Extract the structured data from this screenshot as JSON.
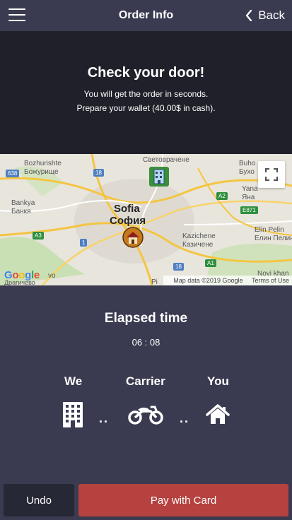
{
  "header": {
    "title": "Order Info",
    "back_label": "Back"
  },
  "banner": {
    "heading": "Check your door!",
    "line1": "You will get the order in seconds.",
    "line2": "Prepare your wallet (40.00$ in cash)."
  },
  "map": {
    "city_latin": "Sofia",
    "city_cyrillic": "София",
    "labels": {
      "bozhurishte": "Bozhurishte",
      "bozhurishte_cyr": "Божурище",
      "svetovrachene": "Световрачене",
      "bukhovo": "Buho",
      "bukhovo_cyr": "Бухо",
      "bankya": "Bankya",
      "bankya_cyr": "Банкя",
      "yana": "Yana",
      "yana_cyr": "Яна",
      "elin_pelin": "Elin Pelin",
      "elin_pelin_cyr": "Елин Пелин",
      "kazichene": "Kazichene",
      "kazichene_cyr": "Казичене",
      "novi_khan": "Novi khan",
      "vo": "vo",
      "dragichevo": "Драгичево",
      "pi": "Pi"
    },
    "road_tags": {
      "r638": "638",
      "r18a": "18",
      "a2": "A2",
      "e871": "E871",
      "a3": "A3",
      "r1": "1",
      "r18b": "18",
      "a1": "A1"
    },
    "google_logo": "Google",
    "attribution": "Map data ©2019 Google",
    "terms": "Terms of Use"
  },
  "elapsed": {
    "title": "Elapsed time",
    "time": "06 : 08"
  },
  "progress": {
    "we_label": "We",
    "carrier_label": "Carrier",
    "you_label": "You",
    "dots_left": "..",
    "dots_right": ".."
  },
  "actions": {
    "undo_label": "Undo",
    "pay_label": "Pay with Card"
  },
  "colors": {
    "app_bg": "#3a3b50",
    "banner_bg": "#1f2029",
    "pay_button": "#b5423f",
    "undo_button": "#262835"
  }
}
